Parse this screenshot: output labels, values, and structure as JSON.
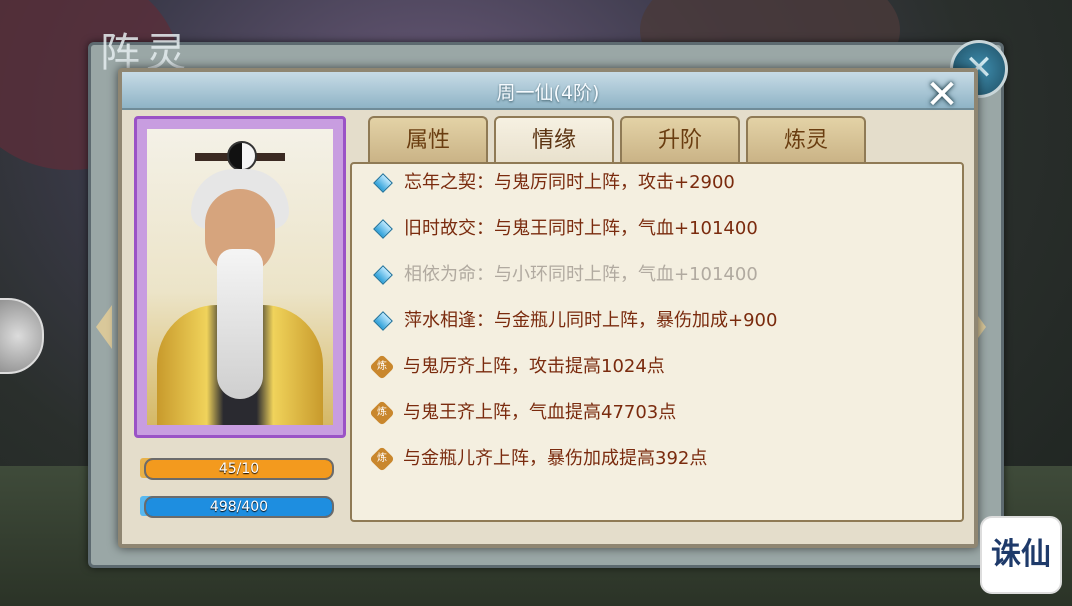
{
  "window": {
    "title": "周一仙(4阶)"
  },
  "background": {
    "title_text": "阵灵"
  },
  "tabs": [
    {
      "label": "属性",
      "active": false
    },
    {
      "label": "情缘",
      "active": true
    },
    {
      "label": "升阶",
      "active": false
    },
    {
      "label": "炼灵",
      "active": false
    }
  ],
  "bars": {
    "level": {
      "text": "45/10",
      "fill_fraction": 1.0,
      "color": "#f39a1e"
    },
    "exp": {
      "text": "498/400",
      "fill_fraction": 1.0,
      "color": "#1e8ee0"
    }
  },
  "bonds": [
    {
      "icon": "diamond",
      "text": "忘年之契：与鬼厉同时上阵，攻击+2900",
      "active": true
    },
    {
      "icon": "diamond",
      "text": "旧时故交：与鬼王同时上阵，气血+101400",
      "active": true
    },
    {
      "icon": "diamond",
      "text": "相依为命：与小环同时上阵，气血+101400",
      "active": false
    },
    {
      "icon": "diamond",
      "text": "萍水相逢：与金瓶儿同时上阵，暴伤加成+900",
      "active": true
    },
    {
      "icon": "lian",
      "badge": "炼",
      "text": "与鬼厉齐上阵，攻击提高1024点",
      "active": true
    },
    {
      "icon": "lian",
      "badge": "炼",
      "text": "与鬼王齐上阵，气血提高47703点",
      "active": true
    },
    {
      "icon": "lian",
      "badge": "炼",
      "text": "与金瓶儿齐上阵，暴伤加成提高392点",
      "active": true
    }
  ],
  "logo": {
    "text": "诛仙"
  },
  "colors": {
    "bond_active": "#7a2b0e",
    "bond_inactive": "#b1aaa0",
    "portrait_frame": "#9a52c6"
  }
}
